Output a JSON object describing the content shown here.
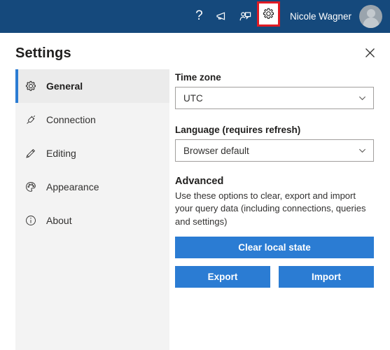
{
  "topbar": {
    "icons": [
      {
        "name": "help-icon",
        "glyph": "?"
      },
      {
        "name": "megaphone-icon"
      },
      {
        "name": "feedback-person-icon"
      },
      {
        "name": "settings-gear-icon"
      }
    ],
    "help_glyph": "?",
    "user_name": "Nicole Wagner",
    "avatar_name": "user-avatar",
    "bar_color": "#15497c",
    "highlight_color": "#e01b24"
  },
  "panel": {
    "title": "Settings",
    "close_label": "✕"
  },
  "sidebar": {
    "items": [
      {
        "label": "General",
        "icon": "gear-icon",
        "active": true
      },
      {
        "label": "Connection",
        "icon": "plug-icon",
        "active": false
      },
      {
        "label": "Editing",
        "icon": "pencil-icon",
        "active": false
      },
      {
        "label": "Appearance",
        "icon": "palette-icon",
        "active": false
      },
      {
        "label": "About",
        "icon": "info-circle-icon",
        "active": false
      }
    ],
    "accent_color": "#2b7cd3",
    "background": "#f3f3f3"
  },
  "content": {
    "timezone": {
      "label": "Time zone",
      "value": "UTC"
    },
    "language": {
      "label": "Language (requires refresh)",
      "value": "Browser default"
    },
    "advanced": {
      "title": "Advanced",
      "description": "Use these options to clear, export and import your query data (including connections, queries and settings)",
      "clear_button": "Clear local state",
      "export_button": "Export",
      "import_button": "Import",
      "button_color": "#2b7cd3"
    }
  }
}
